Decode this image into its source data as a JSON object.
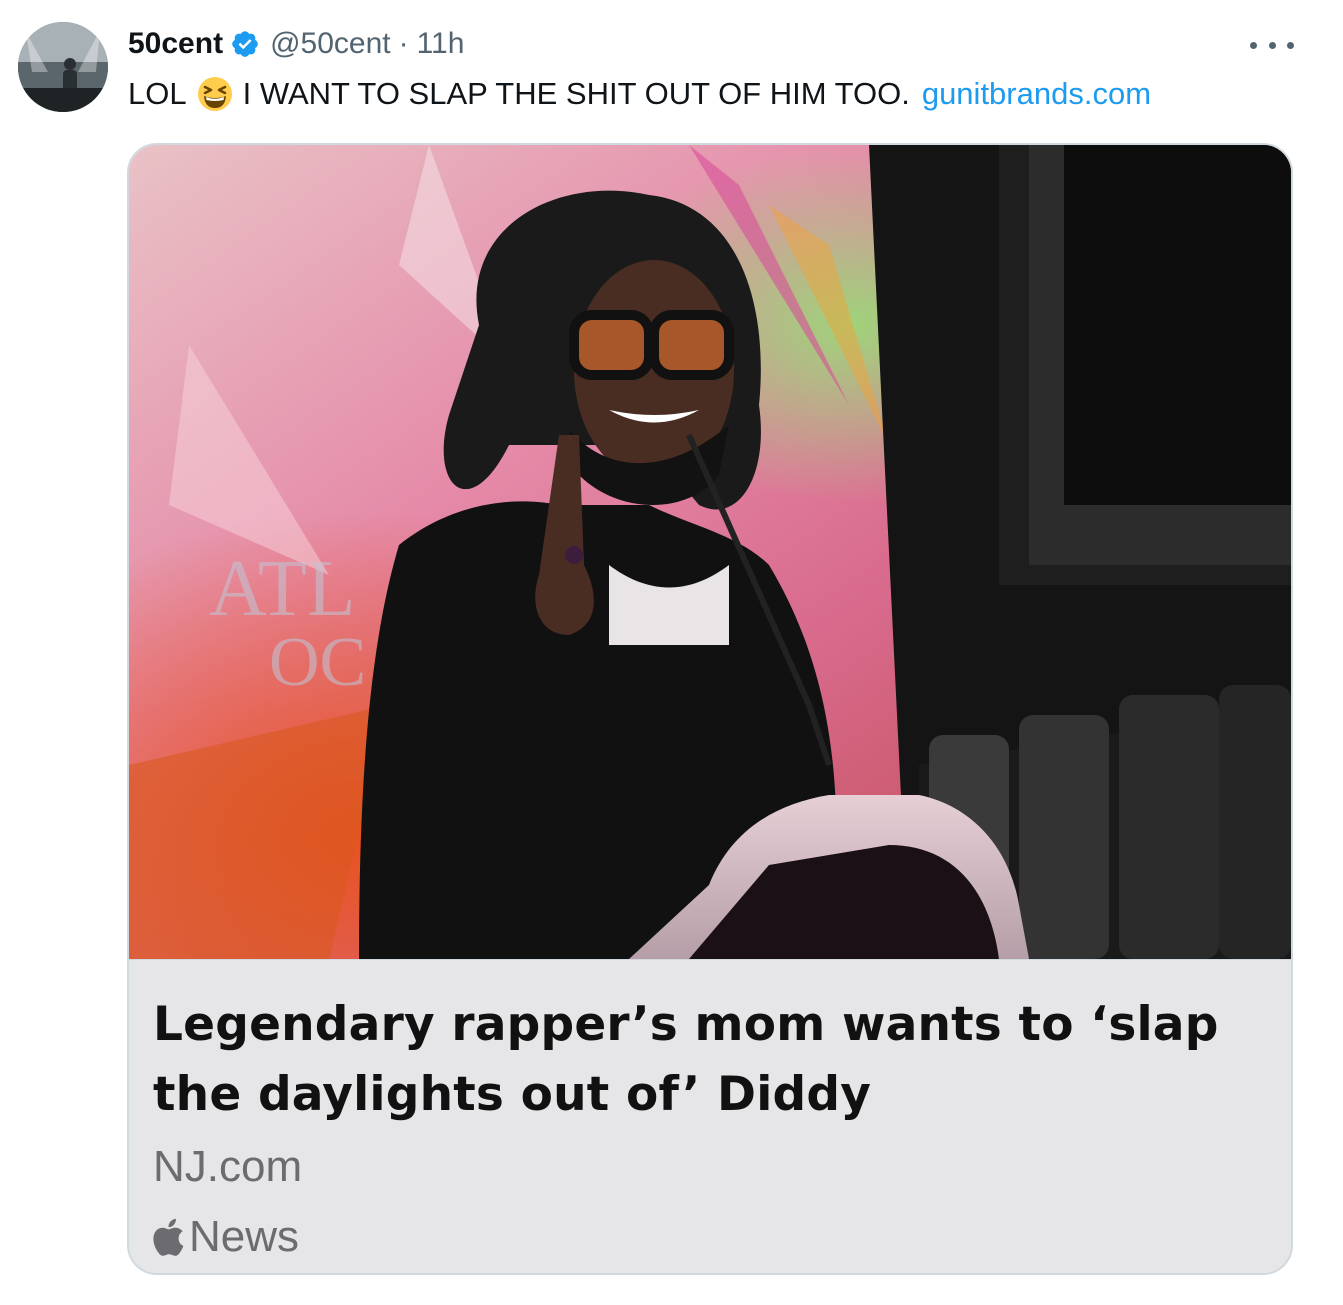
{
  "tweet": {
    "author": {
      "display_name": "50cent",
      "handle": "@50cent",
      "verified": true,
      "avatar_icon": "user-avatar"
    },
    "separator": "·",
    "timestamp": "11h",
    "text_before_emoji": "LOL",
    "emoji": "grinning-squinting-face-emoji",
    "text_after_emoji": "I WANT TO SLAP THE SHIT OUT OF HIM TOO.",
    "link_text": "gunitbrands.com",
    "more_icon": "more-options-icon"
  },
  "card": {
    "image_alt_text": "ATL",
    "image_alt_text_2": "OC",
    "title": "Legendary rapper’s mom wants to ‘slap the daylights out of’ Diddy",
    "source": "NJ.com",
    "brand_label": "News",
    "brand_icon": "apple-icon"
  },
  "colors": {
    "link": "#1d9bf0",
    "verified": "#1d9bf0",
    "secondary_text": "#536471",
    "card_body_bg": "#e6e6e8"
  }
}
